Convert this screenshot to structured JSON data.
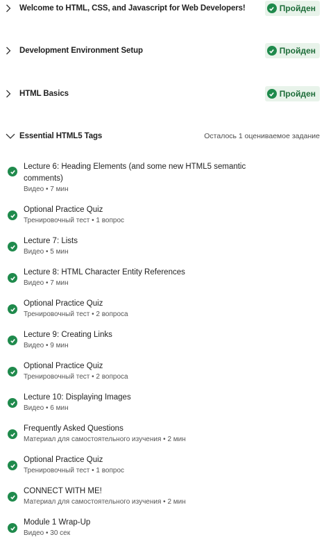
{
  "modules": [
    {
      "title": "Welcome to HTML, CSS, and Javascript for Web Developers!",
      "status": "Пройден"
    },
    {
      "title": "Development Environment Setup",
      "status": "Пройден"
    },
    {
      "title": "HTML Basics",
      "status": "Пройден"
    },
    {
      "title": "Essential HTML5 Tags",
      "remaining": "Осталось 1 оцениваемое задание"
    }
  ],
  "items": [
    {
      "title": "Lecture 6: Heading Elements (and some new HTML5 semantic comments)",
      "meta": "Видео • 7 мин"
    },
    {
      "title": "Optional Practice Quiz",
      "meta": "Тренировочный тест • 1 вопрос"
    },
    {
      "title": "Lecture 7: Lists",
      "meta": "Видео • 5 мин"
    },
    {
      "title": "Lecture 8: HTML Character Entity References",
      "meta": "Видео • 7 мин"
    },
    {
      "title": "Optional Practice Quiz",
      "meta": "Тренировочный тест • 2 вопроса"
    },
    {
      "title": "Lecture 9: Creating Links",
      "meta": "Видео • 9 мин"
    },
    {
      "title": "Optional Practice Quiz",
      "meta": "Тренировочный тест • 2 вопроса"
    },
    {
      "title": "Lecture 10: Displaying Images",
      "meta": "Видео • 6 мин"
    },
    {
      "title": "Frequently Asked Questions",
      "meta": "Материал для самостоятельного изучения • 2 мин"
    },
    {
      "title": "Optional Practice Quiz",
      "meta": "Тренировочный тест • 1 вопрос"
    },
    {
      "title": "CONNECT WITH ME!",
      "meta": "Материал для самостоятельного изучения • 2 мин"
    },
    {
      "title": "Module 1 Wrap-Up",
      "meta": "Видео • 30 сек"
    }
  ],
  "colors": {
    "check": "#1f8a4c",
    "badge_bg": "#e8f3ea",
    "badge_text": "#1e6d3a"
  }
}
